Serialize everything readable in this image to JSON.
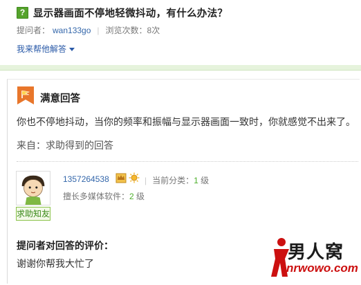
{
  "question": {
    "icon_char": "?",
    "title": "显示器画面不停地轻微抖动，有什么办法？",
    "asker_label": "提问者：",
    "asker_name": "wan133go",
    "views_label": "浏览次数：8次",
    "help_link": "我来帮他解答"
  },
  "answer": {
    "section_title": "满意回答",
    "text": "你也不停地抖动，当你的频率和振幅与显示器画面一致时，你就感觉不出来了。",
    "source": "来自：求助得到的回答"
  },
  "answerer": {
    "avatar_label": "求助知友",
    "name": "1357264538",
    "category_label": "当前分类：",
    "category_level": "1",
    "level_suffix": "级",
    "good_at_label": "擅长多媒体软件：",
    "good_at_level": "2",
    "good_at_suffix": "级"
  },
  "evaluation": {
    "title": "提问者对回答的评价：",
    "text": "谢谢你帮我大忙了"
  },
  "watermark": {
    "cn": "男人窝",
    "en": "nrwowo.com"
  },
  "colors": {
    "accent_green": "#55a32c",
    "link_blue": "#3366aa",
    "logo_red": "#cc1010"
  }
}
